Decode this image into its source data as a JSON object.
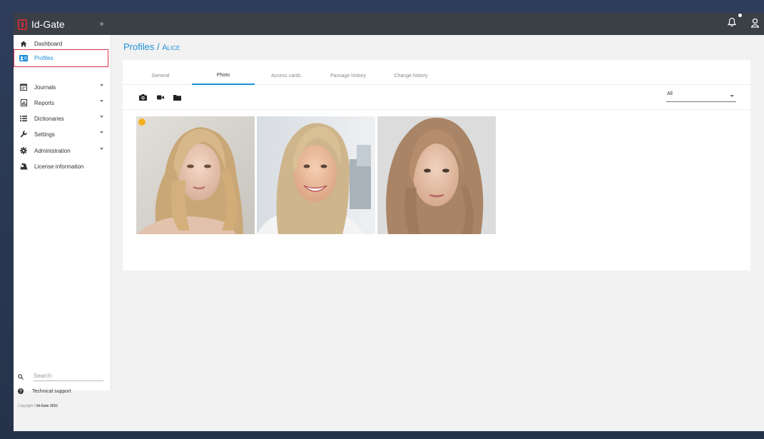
{
  "app": {
    "brand_name": "Id-Gate",
    "accent_color": "#1a8fd8",
    "topbar_color": "#3b3f46"
  },
  "topbar": {
    "icons": [
      "bell-icon",
      "user-icon"
    ]
  },
  "sidebar": {
    "items": [
      {
        "label": "Dashboard",
        "icon": "home-icon",
        "has_submenu": false,
        "active": false
      },
      {
        "label": "Profiles",
        "icon": "id-card-icon",
        "has_submenu": false,
        "active": true
      },
      {
        "label": "Journals",
        "icon": "calendar-icon",
        "has_submenu": true,
        "active": false
      },
      {
        "label": "Reports",
        "icon": "report-icon",
        "has_submenu": true,
        "active": false
      },
      {
        "label": "Dictionaries",
        "icon": "list-icon",
        "has_submenu": true,
        "active": false
      },
      {
        "label": "Settings",
        "icon": "wrench-icon",
        "has_submenu": true,
        "active": false
      },
      {
        "label": "Administration",
        "icon": "gear-icon",
        "has_submenu": true,
        "active": false
      },
      {
        "label": "License information",
        "icon": "license-icon",
        "has_submenu": false,
        "active": false
      }
    ],
    "search_placeholder": "Search",
    "support_label": "Technical support",
    "copyright_prefix": "Copyright ©",
    "copyright_brand": "Id-Gate 2021"
  },
  "breadcrumb": {
    "section": "Profiles",
    "separator": " / ",
    "current": "Alice"
  },
  "tabs": [
    {
      "label": "General",
      "active": false
    },
    {
      "label": "Photo",
      "active": true
    },
    {
      "label": "Access cards",
      "active": false
    },
    {
      "label": "Passage history",
      "active": false
    },
    {
      "label": "Change history",
      "active": false
    }
  ],
  "photo_toolbar": {
    "icons": [
      "camera-icon",
      "video-icon",
      "folder-icon"
    ],
    "filter_value": "All"
  },
  "photos": [
    {
      "name": "photo-1",
      "is_primary": true
    },
    {
      "name": "photo-2",
      "is_primary": false
    },
    {
      "name": "photo-3",
      "is_primary": false
    }
  ]
}
